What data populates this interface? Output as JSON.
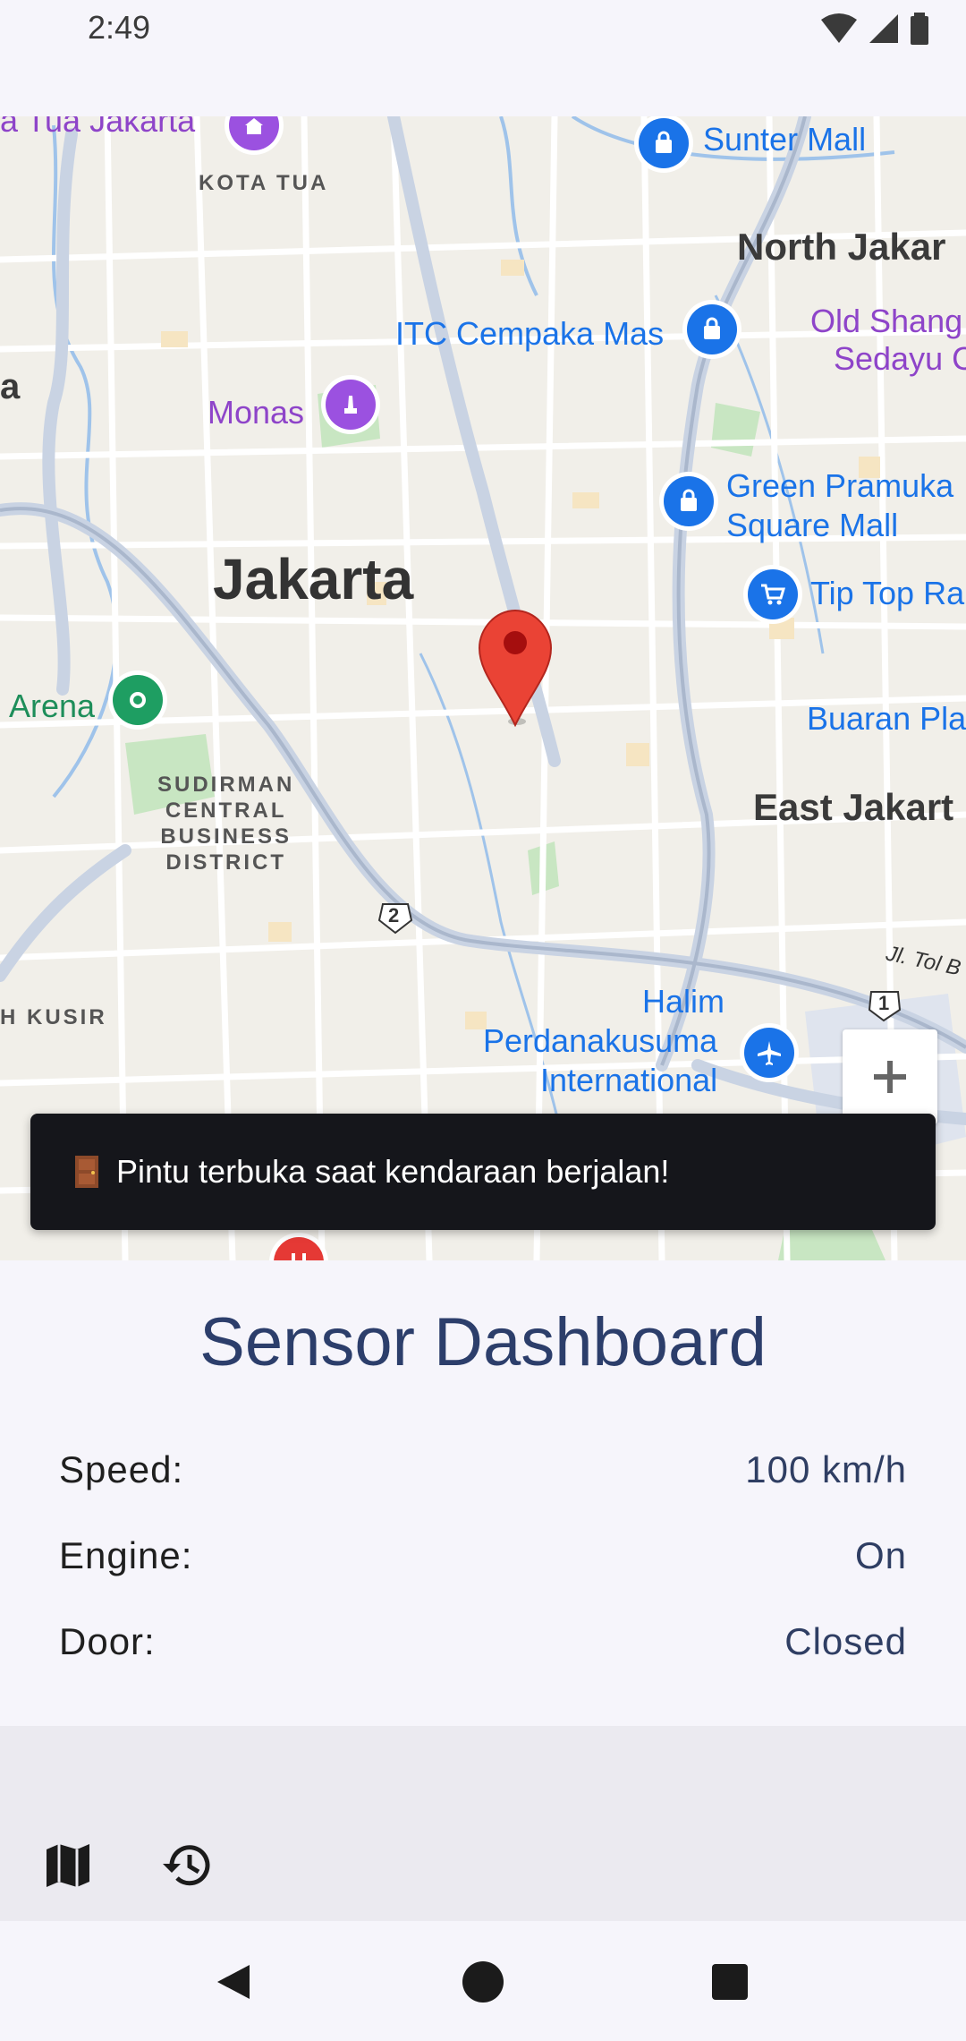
{
  "status_bar": {
    "time": "2:49"
  },
  "map": {
    "labels": {
      "kota_tua_top": "ta Tua Jakarta",
      "kota_tua": "KOTA TUA",
      "sunter_mall": "Sunter Mall",
      "north_jakarta": "North Jakar",
      "itc_cempaka": "ITC Cempaka Mas",
      "old_shang_1": "Old Shang",
      "old_shang_2": "Sedayu C",
      "left_a": "a",
      "monas": "Monas",
      "green_pramuka_1": "Green Pramuka",
      "green_pramuka_2": "Square Mall",
      "jakarta": "Jakarta",
      "tip_top": "Tip Top Ra",
      "arena": "Arena",
      "buaran": "Buaran Pla",
      "sudirman_1": "SUDIRMAN",
      "sudirman_2": "CENTRAL",
      "sudirman_3": "BUSINESS",
      "sudirman_4": "DISTRICT",
      "east_jakarta": "East Jakart",
      "route_2": "2",
      "jl_tol": "Jl. Tol B",
      "route_1": "1",
      "h_kusir": "H KUSIR",
      "halim_1": "Halim",
      "halim_2": "Perdanakusuma",
      "halim_3": "International"
    },
    "zoom_in_label": "+"
  },
  "snackbar": {
    "message": "Pintu terbuka saat kendaraan berjalan!"
  },
  "dashboard": {
    "title": "Sensor Dashboard",
    "rows": [
      {
        "label": "Speed:",
        "value": "100 km/h"
      },
      {
        "label": "Engine:",
        "value": "On"
      },
      {
        "label": "Door:",
        "value": "Closed"
      }
    ]
  },
  "bottom_nav": {
    "items": [
      {
        "icon": "map-icon"
      },
      {
        "icon": "history-icon"
      }
    ]
  },
  "system_nav": {
    "items": [
      "back",
      "home",
      "recents"
    ]
  }
}
